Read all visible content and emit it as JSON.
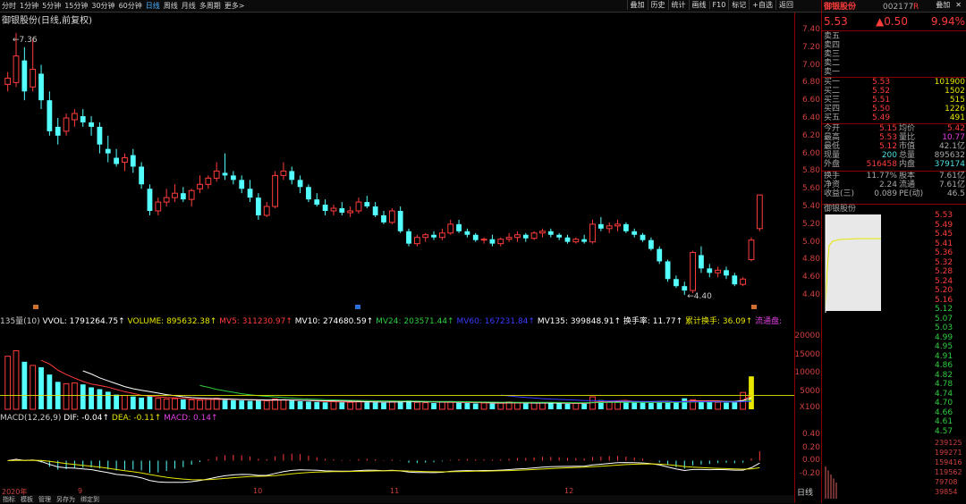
{
  "topbar": {
    "periods": [
      "分时",
      "1分钟",
      "5分钟",
      "15分钟",
      "30分钟",
      "60分钟",
      "日线",
      "周线",
      "月线",
      "多周期",
      "更多>"
    ],
    "active_period": "日线",
    "tools": [
      "叠加",
      "历史",
      "统计",
      "画线",
      "F10",
      "标记",
      "+自选",
      "返回"
    ],
    "win_controls": [
      "叠加",
      "✕"
    ]
  },
  "main_chart": {
    "title": "御银股份(日线,前复权)",
    "high_marker": "7.36",
    "low_marker": "4.40"
  },
  "price_axis": [
    "7.40",
    "7.20",
    "7.00",
    "6.80",
    "6.60",
    "6.40",
    "6.20",
    "6.00",
    "5.80",
    "5.60",
    "5.40",
    "5.20",
    "5.00",
    "4.80",
    "4.60",
    "4.40"
  ],
  "volume_axis": [
    "20000",
    "15000",
    "10000",
    "5000",
    "X100"
  ],
  "macd_axis": [
    "0.40",
    "0.20",
    "0.00",
    "-0.20"
  ],
  "indicator_line": {
    "prefix": "135量(10)",
    "items": [
      {
        "label": "VVOL:",
        "value": "1791264.75↑",
        "color": "#ffffff"
      },
      {
        "label": "VOLUME:",
        "value": "895632.38↑",
        "color": "#e6e600"
      },
      {
        "label": "MV5:",
        "value": "311230.97↑",
        "color": "#ff3c3c"
      },
      {
        "label": "MV10:",
        "value": "274680.59↑",
        "color": "#ffffff"
      },
      {
        "label": "MV24:",
        "value": "203571.44↑",
        "color": "#2ecc40"
      },
      {
        "label": "MV60:",
        "value": "167231.84↑",
        "color": "#3a3aff"
      },
      {
        "label": "MV135:",
        "value": "399848.91↑",
        "color": "#ffffff"
      },
      {
        "label": "换手率:",
        "value": "11.77↑",
        "color": "#ffffff"
      },
      {
        "label": "累计换手:",
        "value": "36.09↑",
        "color": "#e6e600"
      },
      {
        "label": "流通盘:",
        "value": "",
        "color": "#e040e0"
      }
    ]
  },
  "macd_line": {
    "prefix": "MACD(12,26,9)",
    "items": [
      {
        "label": "DIF:",
        "value": "-0.04↑",
        "color": "#ffffff"
      },
      {
        "label": "DEA:",
        "value": "-0.11↑",
        "color": "#e6e600"
      },
      {
        "label": "MACD:",
        "value": "0.14↑",
        "color": "#e040e0"
      }
    ]
  },
  "dates": [
    "2020年",
    "9",
    "10",
    "11",
    "12"
  ],
  "bottom_tabs": [
    "指标",
    "模板",
    "管理",
    "另存为",
    "绑定到"
  ],
  "panel": {
    "stock_name": "御银股份",
    "stock_code": "002177",
    "flag": "R",
    "price": "5.53",
    "change": "▲0.50",
    "change_pct": "9.94%",
    "asks": [
      {
        "label": "卖五",
        "price": "",
        "vol": ""
      },
      {
        "label": "卖四",
        "price": "",
        "vol": ""
      },
      {
        "label": "卖三",
        "price": "",
        "vol": ""
      },
      {
        "label": "卖二",
        "price": "",
        "vol": ""
      },
      {
        "label": "卖一",
        "price": "",
        "vol": ""
      }
    ],
    "bids": [
      {
        "label": "买一",
        "price": "5.53",
        "vol": "101900"
      },
      {
        "label": "买二",
        "price": "5.52",
        "vol": "1502"
      },
      {
        "label": "买三",
        "price": "5.51",
        "vol": "515"
      },
      {
        "label": "买四",
        "price": "5.50",
        "vol": "1226"
      },
      {
        "label": "买五",
        "price": "5.49",
        "vol": "491"
      }
    ],
    "stats": [
      {
        "l1": "今开",
        "v1": "5.15",
        "l2": "均价",
        "v2": "5.42",
        "c1": "red",
        "c2": "red"
      },
      {
        "l1": "最高",
        "v1": "5.53",
        "l2": "量比",
        "v2": "10.77",
        "c1": "red",
        "c2": "mag"
      },
      {
        "l1": "最低",
        "v1": "5.12",
        "l2": "市值",
        "v2": "42.1亿",
        "c1": "red",
        "c2": "gry"
      },
      {
        "l1": "现量",
        "v1": "200",
        "l2": "总量",
        "v2": "895632",
        "c1": "cyan",
        "c2": "gry"
      },
      {
        "l1": "外盘",
        "v1": "516458",
        "l2": "内盘",
        "v2": "379174",
        "c1": "red",
        "c2": "cyan"
      },
      {
        "l1": "换手",
        "v1": "11.77%",
        "l2": "股本",
        "v2": "7.61亿",
        "c1": "gry",
        "c2": "gry"
      },
      {
        "l1": "净资",
        "v1": "2.24",
        "l2": "流通",
        "v2": "7.61亿",
        "c1": "gry",
        "c2": "gry"
      },
      {
        "l1": "收益(三)",
        "v1": "0.089",
        "l2": "PE(动)",
        "v2": "46.5",
        "c1": "gry",
        "c2": "gry"
      }
    ],
    "intraday_title": "御银股份",
    "intraday_axis": [
      "5.53",
      "5.49",
      "5.45",
      "5.41",
      "5.36",
      "5.32",
      "5.28",
      "5.24",
      "5.20",
      "5.16",
      "5.12",
      "5.07",
      "5.03",
      "4.99",
      "4.95",
      "4.91",
      "4.86",
      "4.82",
      "4.78",
      "4.74",
      "4.70",
      "4.66",
      "4.61",
      "4.57"
    ],
    "intraday_vol_axis": [
      "239125",
      "199271",
      "159416",
      "119562",
      "79708",
      "39854"
    ],
    "period_label": "日线"
  },
  "colors": {
    "up": "#ff3c3c",
    "down": "#54ffff",
    "ma5": "#ffffff",
    "ma10": "#e6e600",
    "ma20": "#e040e0",
    "ma60": "#2ecc40"
  },
  "chart_data": {
    "type": "candlestick",
    "ylim": [
      4.3,
      7.45
    ],
    "candles": [
      {
        "o": 6.78,
        "h": 6.92,
        "l": 6.7,
        "c": 6.85
      },
      {
        "o": 6.8,
        "h": 7.36,
        "l": 6.75,
        "c": 7.1
      },
      {
        "o": 7.05,
        "h": 7.2,
        "l": 6.6,
        "c": 6.7
      },
      {
        "o": 6.75,
        "h": 7.3,
        "l": 6.7,
        "c": 6.95
      },
      {
        "o": 6.9,
        "h": 7.0,
        "l": 6.5,
        "c": 6.6
      },
      {
        "o": 6.6,
        "h": 6.7,
        "l": 6.2,
        "c": 6.25
      },
      {
        "o": 6.3,
        "h": 6.4,
        "l": 6.1,
        "c": 6.2
      },
      {
        "o": 6.25,
        "h": 6.45,
        "l": 6.2,
        "c": 6.4
      },
      {
        "o": 6.38,
        "h": 6.5,
        "l": 6.3,
        "c": 6.45
      },
      {
        "o": 6.42,
        "h": 6.5,
        "l": 6.3,
        "c": 6.35
      },
      {
        "o": 6.35,
        "h": 6.42,
        "l": 6.2,
        "c": 6.3
      },
      {
        "o": 6.3,
        "h": 6.35,
        "l": 6.0,
        "c": 6.1
      },
      {
        "o": 6.05,
        "h": 6.2,
        "l": 5.9,
        "c": 6.0
      },
      {
        "o": 5.95,
        "h": 6.05,
        "l": 5.85,
        "c": 5.88
      },
      {
        "o": 5.9,
        "h": 6.0,
        "l": 5.8,
        "c": 5.95
      },
      {
        "o": 5.98,
        "h": 6.05,
        "l": 5.78,
        "c": 5.85
      },
      {
        "o": 5.85,
        "h": 5.9,
        "l": 5.6,
        "c": 5.65
      },
      {
        "o": 5.6,
        "h": 5.65,
        "l": 5.3,
        "c": 5.35
      },
      {
        "o": 5.35,
        "h": 5.5,
        "l": 5.3,
        "c": 5.45
      },
      {
        "o": 5.45,
        "h": 5.6,
        "l": 5.4,
        "c": 5.5
      },
      {
        "o": 5.5,
        "h": 5.65,
        "l": 5.45,
        "c": 5.55
      },
      {
        "o": 5.55,
        "h": 5.62,
        "l": 5.45,
        "c": 5.48
      },
      {
        "o": 5.48,
        "h": 5.6,
        "l": 5.4,
        "c": 5.58
      },
      {
        "o": 5.6,
        "h": 5.75,
        "l": 5.55,
        "c": 5.65
      },
      {
        "o": 5.65,
        "h": 5.75,
        "l": 5.6,
        "c": 5.72
      },
      {
        "o": 5.72,
        "h": 5.9,
        "l": 5.68,
        "c": 5.8
      },
      {
        "o": 5.78,
        "h": 6.0,
        "l": 5.7,
        "c": 5.75
      },
      {
        "o": 5.75,
        "h": 5.8,
        "l": 5.65,
        "c": 5.7
      },
      {
        "o": 5.7,
        "h": 5.75,
        "l": 5.55,
        "c": 5.6
      },
      {
        "o": 5.6,
        "h": 5.7,
        "l": 5.45,
        "c": 5.5
      },
      {
        "o": 5.5,
        "h": 5.55,
        "l": 5.25,
        "c": 5.3
      },
      {
        "o": 5.3,
        "h": 5.45,
        "l": 5.28,
        "c": 5.4
      },
      {
        "o": 5.4,
        "h": 5.8,
        "l": 5.38,
        "c": 5.75
      },
      {
        "o": 5.75,
        "h": 5.9,
        "l": 5.7,
        "c": 5.8
      },
      {
        "o": 5.8,
        "h": 5.85,
        "l": 5.65,
        "c": 5.7
      },
      {
        "o": 5.7,
        "h": 5.75,
        "l": 5.55,
        "c": 5.62
      },
      {
        "o": 5.62,
        "h": 5.65,
        "l": 5.45,
        "c": 5.48
      },
      {
        "o": 5.48,
        "h": 5.55,
        "l": 5.4,
        "c": 5.42
      },
      {
        "o": 5.42,
        "h": 5.48,
        "l": 5.3,
        "c": 5.35
      },
      {
        "o": 5.35,
        "h": 5.42,
        "l": 5.3,
        "c": 5.38
      },
      {
        "o": 5.38,
        "h": 5.45,
        "l": 5.3,
        "c": 5.33
      },
      {
        "o": 5.33,
        "h": 5.4,
        "l": 5.28,
        "c": 5.35
      },
      {
        "o": 5.35,
        "h": 5.5,
        "l": 5.32,
        "c": 5.45
      },
      {
        "o": 5.45,
        "h": 5.52,
        "l": 5.38,
        "c": 5.4
      },
      {
        "o": 5.4,
        "h": 5.45,
        "l": 5.28,
        "c": 5.3
      },
      {
        "o": 5.3,
        "h": 5.35,
        "l": 5.2,
        "c": 5.22
      },
      {
        "o": 5.22,
        "h": 5.38,
        "l": 5.2,
        "c": 5.35
      },
      {
        "o": 5.35,
        "h": 5.4,
        "l": 5.1,
        "c": 5.12
      },
      {
        "o": 5.12,
        "h": 5.15,
        "l": 4.95,
        "c": 4.98
      },
      {
        "o": 4.98,
        "h": 5.08,
        "l": 4.95,
        "c": 5.05
      },
      {
        "o": 5.05,
        "h": 5.1,
        "l": 5.0,
        "c": 5.08
      },
      {
        "o": 5.08,
        "h": 5.12,
        "l": 5.02,
        "c": 5.05
      },
      {
        "o": 5.05,
        "h": 5.15,
        "l": 5.02,
        "c": 5.1
      },
      {
        "o": 5.1,
        "h": 5.25,
        "l": 5.08,
        "c": 5.2
      },
      {
        "o": 5.2,
        "h": 5.25,
        "l": 5.1,
        "c": 5.12
      },
      {
        "o": 5.12,
        "h": 5.15,
        "l": 5.05,
        "c": 5.08
      },
      {
        "o": 5.08,
        "h": 5.1,
        "l": 5.0,
        "c": 5.02
      },
      {
        "o": 5.02,
        "h": 5.05,
        "l": 4.98,
        "c": 5.03
      },
      {
        "o": 5.03,
        "h": 5.08,
        "l": 4.95,
        "c": 4.98
      },
      {
        "o": 4.98,
        "h": 5.05,
        "l": 4.95,
        "c": 5.03
      },
      {
        "o": 5.03,
        "h": 5.1,
        "l": 5.0,
        "c": 5.05
      },
      {
        "o": 5.05,
        "h": 5.12,
        "l": 5.0,
        "c": 5.08
      },
      {
        "o": 5.08,
        "h": 5.1,
        "l": 5.0,
        "c": 5.04
      },
      {
        "o": 5.04,
        "h": 5.12,
        "l": 5.02,
        "c": 5.1
      },
      {
        "o": 5.1,
        "h": 5.15,
        "l": 5.05,
        "c": 5.12
      },
      {
        "o": 5.12,
        "h": 5.15,
        "l": 5.05,
        "c": 5.08
      },
      {
        "o": 5.08,
        "h": 5.1,
        "l": 5.02,
        "c": 5.05
      },
      {
        "o": 5.05,
        "h": 5.08,
        "l": 4.98,
        "c": 5.0
      },
      {
        "o": 5.0,
        "h": 5.05,
        "l": 4.98,
        "c": 5.03
      },
      {
        "o": 5.03,
        "h": 5.08,
        "l": 4.98,
        "c": 5.0
      },
      {
        "o": 5.0,
        "h": 5.25,
        "l": 4.98,
        "c": 5.2
      },
      {
        "o": 5.2,
        "h": 5.28,
        "l": 5.12,
        "c": 5.15
      },
      {
        "o": 5.15,
        "h": 5.22,
        "l": 5.1,
        "c": 5.18
      },
      {
        "o": 5.18,
        "h": 5.25,
        "l": 5.12,
        "c": 5.2
      },
      {
        "o": 5.2,
        "h": 5.22,
        "l": 5.1,
        "c": 5.12
      },
      {
        "o": 5.12,
        "h": 5.15,
        "l": 5.05,
        "c": 5.08
      },
      {
        "o": 5.08,
        "h": 5.1,
        "l": 5.0,
        "c": 5.02
      },
      {
        "o": 5.02,
        "h": 5.05,
        "l": 4.9,
        "c": 4.92
      },
      {
        "o": 4.92,
        "h": 4.95,
        "l": 4.75,
        "c": 4.78
      },
      {
        "o": 4.78,
        "h": 4.8,
        "l": 4.55,
        "c": 4.58
      },
      {
        "o": 4.58,
        "h": 4.62,
        "l": 4.48,
        "c": 4.5
      },
      {
        "o": 4.5,
        "h": 4.55,
        "l": 4.4,
        "c": 4.45
      },
      {
        "o": 4.45,
        "h": 4.9,
        "l": 4.42,
        "c": 4.88
      },
      {
        "o": 4.85,
        "h": 4.95,
        "l": 4.65,
        "c": 4.7
      },
      {
        "o": 4.7,
        "h": 4.75,
        "l": 4.6,
        "c": 4.65
      },
      {
        "o": 4.65,
        "h": 4.72,
        "l": 4.6,
        "c": 4.68
      },
      {
        "o": 4.68,
        "h": 4.72,
        "l": 4.58,
        "c": 4.62
      },
      {
        "o": 4.62,
        "h": 4.65,
        "l": 4.5,
        "c": 4.52
      },
      {
        "o": 4.52,
        "h": 4.6,
        "l": 4.5,
        "c": 4.58
      },
      {
        "o": 4.8,
        "h": 5.05,
        "l": 4.78,
        "c": 5.02
      },
      {
        "o": 5.15,
        "h": 5.53,
        "l": 5.12,
        "c": 5.53
      }
    ],
    "volumes": [
      14500,
      16000,
      13000,
      12000,
      11500,
      9500,
      7500,
      7000,
      7200,
      6800,
      6000,
      5500,
      4800,
      4000,
      3800,
      3500,
      3200,
      3600,
      3000,
      2800,
      2900,
      2700,
      2600,
      2500,
      2700,
      3000,
      2600,
      2500,
      2400,
      2300,
      2600,
      2300,
      2800,
      2600,
      2400,
      2200,
      2100,
      2000,
      1900,
      2100,
      2000,
      1900,
      2200,
      2000,
      1900,
      1800,
      2100,
      2300,
      2400,
      1900,
      1800,
      1700,
      2000,
      2100,
      1800,
      1700,
      1600,
      1700,
      1600,
      1700,
      2000,
      1800,
      1600,
      1700,
      1800,
      1700,
      1600,
      1500,
      1600,
      1500,
      3400,
      2500,
      2100,
      2200,
      2000,
      1900,
      1800,
      1700,
      2200,
      1900,
      2000,
      3000,
      2600,
      2100,
      2000,
      1900,
      1800,
      2000,
      4600,
      9000
    ],
    "volume_ylim": [
      0,
      22000
    ],
    "macd_ylim": [
      -0.35,
      0.5
    ]
  }
}
